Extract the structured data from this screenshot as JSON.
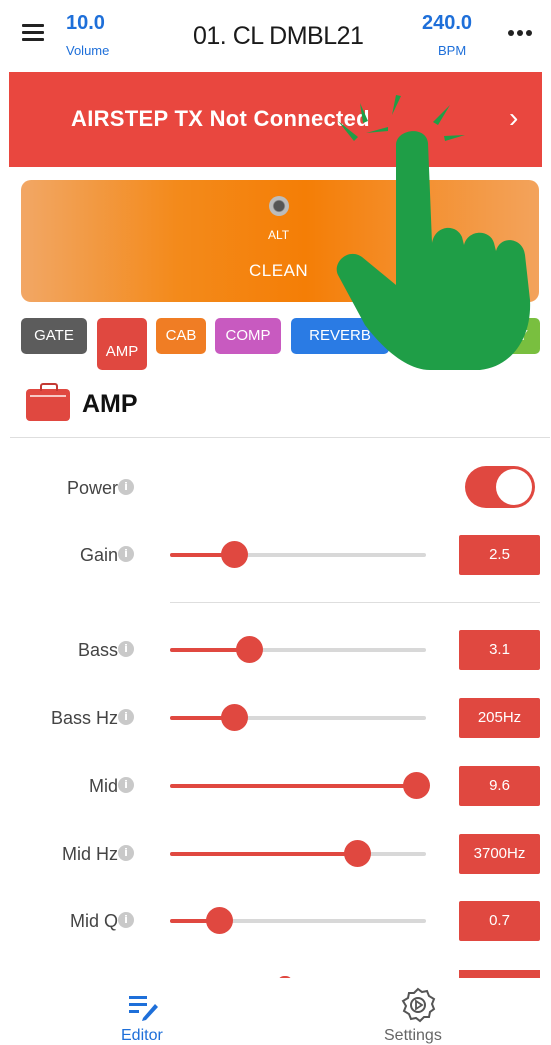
{
  "header": {
    "volume_value": "10.0",
    "volume_label": "Volume",
    "preset_title": "01. CL DMBL21",
    "bpm_value": "240.0",
    "bpm_label": "BPM"
  },
  "banner": {
    "text": "AIRSTEP TX Not Connected",
    "chevron": "›"
  },
  "preset_card": {
    "alt_label": "ALT",
    "name": "CLEAN",
    "led_color": "#555555"
  },
  "tabs": [
    {
      "label": "GATE",
      "color": "#5c5c5c"
    },
    {
      "label": "AMP",
      "color": "#e04840"
    },
    {
      "label": "CAB",
      "color": "#f07d24"
    },
    {
      "label": "COMP",
      "color": "#c85ac0"
    },
    {
      "label": "REVERB",
      "color": "#2a7be4"
    },
    {
      "label": "",
      "color": "#e8c52a"
    },
    {
      "label": "Y",
      "color": "#79bf3f"
    }
  ],
  "section": {
    "title": "AMP"
  },
  "power": {
    "label": "Power",
    "on": true
  },
  "params": [
    {
      "label": "Gain",
      "value": "2.5",
      "level": 0.25
    },
    {
      "label": "Bass",
      "value": "3.1",
      "level": 0.31
    },
    {
      "label": "Bass Hz",
      "value": "205Hz",
      "level": 0.25
    },
    {
      "label": "Mid",
      "value": "9.6",
      "level": 0.96
    },
    {
      "label": "Mid Hz",
      "value": "3700Hz",
      "level": 0.73
    },
    {
      "label": "Mid Q",
      "value": "0.7",
      "level": 0.19
    }
  ],
  "info_glyph": "i",
  "nav": {
    "editor_label": "Editor",
    "settings_label": "Settings"
  },
  "colors": {
    "accent": "#e04840",
    "link": "#1e6fd9",
    "hand": "#1f9e47"
  }
}
